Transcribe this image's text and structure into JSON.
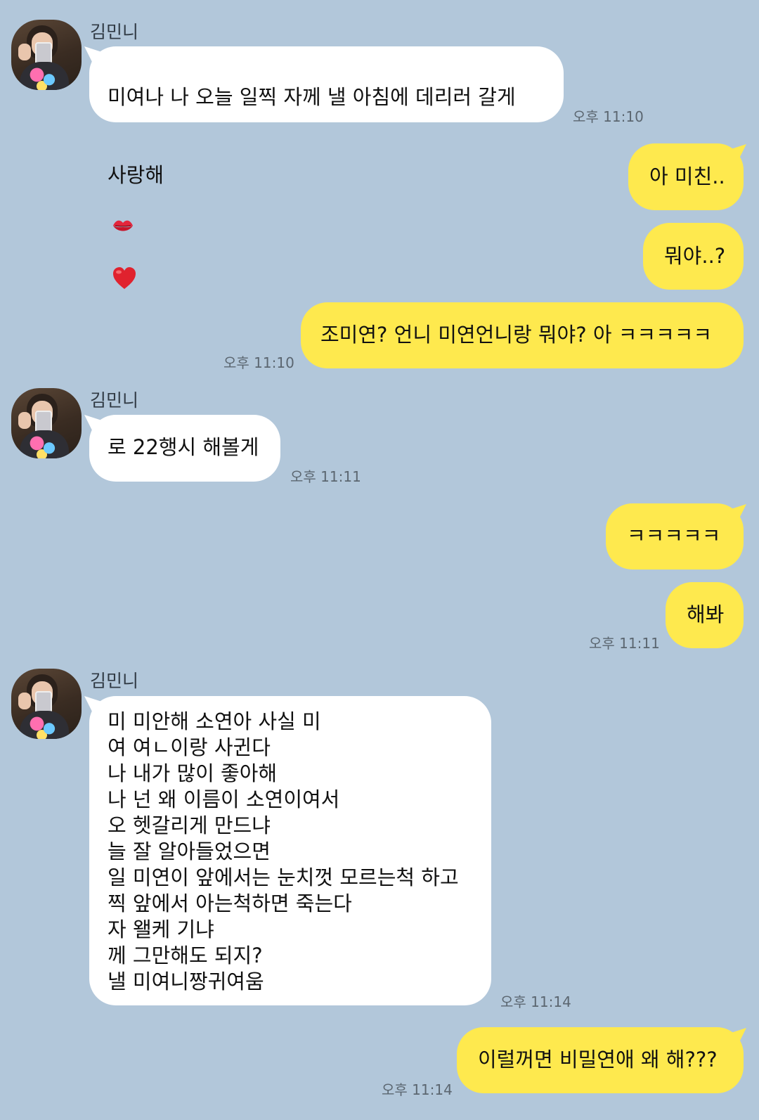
{
  "messages": [
    {
      "sender": "김민니",
      "text_line1": "미여나 나 오늘 일찍 자께 낼 아침에 데리러 갈게",
      "text_line2": "사랑해",
      "time": "오후 11:10"
    },
    {
      "text": "아 미친.."
    },
    {
      "text": "뭐야..?"
    },
    {
      "text": "조미연? 언니 미연언니랑 뭐야? 아 ㅋㅋㅋㅋㅋ",
      "time": "오후 11:10"
    },
    {
      "sender": "김민니",
      "text": "로 22행시 해볼게",
      "time": "오후 11:11"
    },
    {
      "text": "ㅋㅋㅋㅋㅋ"
    },
    {
      "text": "해봐",
      "time": "오후 11:11"
    },
    {
      "sender": "김민니",
      "text": "미 미안해 소연아 사실 미\n여 여ㄴ이랑 사귄다\n나 내가 많이 좋아해\n나 넌 왜 이름이 소연이여서\n오 헷갈리게 만드냐\n늘 잘 알아들었으면\n일 미연이 앞에서는 눈치껏 모르는척 하고\n찍 앞에서 아는척하면 죽는다\n자 왤케 기냐\n께 그만해도 되지?\n낼 미여니짱귀여움",
      "time": "오후 11:14"
    },
    {
      "text": "이럴꺼면 비밀연애 왜 해???",
      "time": "오후 11:14"
    }
  ],
  "colors": {
    "background": "#b2c7da",
    "incoming_bubble": "#ffffff",
    "outgoing_bubble": "#fee94e"
  },
  "icons": [
    "lips-emoji",
    "heart-emoji"
  ]
}
